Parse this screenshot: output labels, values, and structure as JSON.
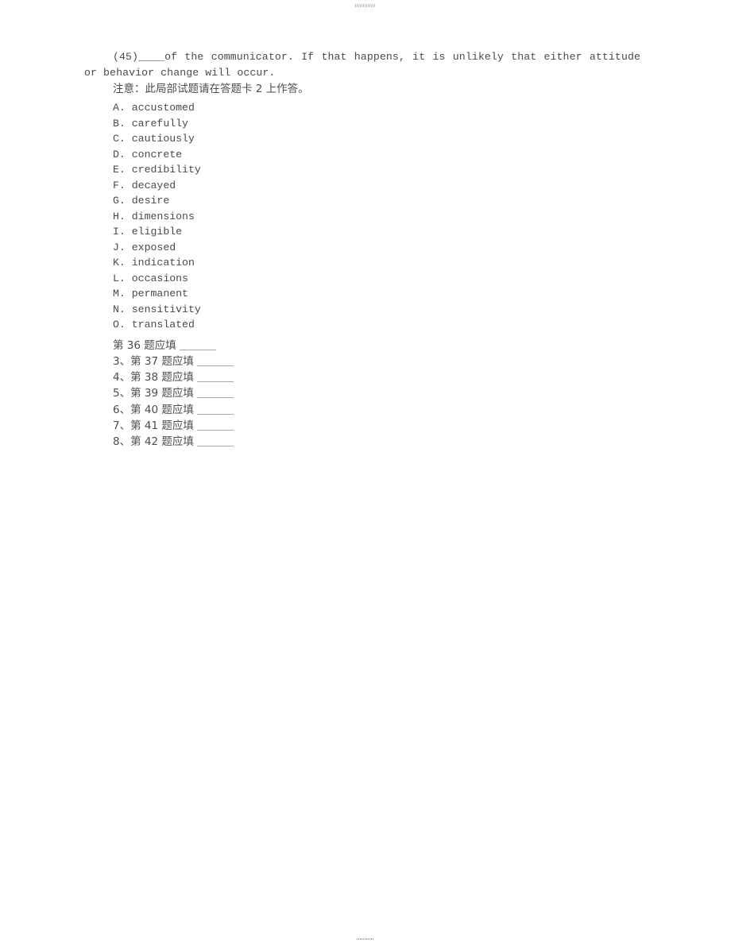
{
  "page": {
    "artifact_top": "scan-artifact-mark",
    "artifact_bottom": "scan-artifact-mark"
  },
  "passage": {
    "question_number": "(45)",
    "text_after_blank": "of the communicator. If that happens,  it is unlikely that either attitude or behavior change will occur."
  },
  "note": {
    "text": "注意：此局部试题请在答题卡 2 上作答。"
  },
  "options": [
    {
      "letter": "A.",
      "word": "accustomed"
    },
    {
      "letter": "B.",
      "word": "carefully"
    },
    {
      "letter": "C.",
      "word": "cautiously"
    },
    {
      "letter": "D.",
      "word": "concrete"
    },
    {
      "letter": "E.",
      "word": "credibility"
    },
    {
      "letter": "F.",
      "word": "decayed"
    },
    {
      "letter": "G.",
      "word": "desire"
    },
    {
      "letter": "H.",
      "word": "dimensions"
    },
    {
      "letter": "I.",
      "word": "eligible"
    },
    {
      "letter": "J.",
      "word": "exposed"
    },
    {
      "letter": "K.",
      "word": "indication"
    },
    {
      "letter": "L.",
      "word": "occasions"
    },
    {
      "letter": "M.",
      "word": "permanent"
    },
    {
      "letter": "N.",
      "word": "sensitivity"
    },
    {
      "letter": "O.",
      "word": "translated"
    }
  ],
  "answer_lines": [
    {
      "index": "",
      "label": "第 36 题应填"
    },
    {
      "index": "3、",
      "label": "第 37 题应填"
    },
    {
      "index": "4、",
      "label": "第 38 题应填"
    },
    {
      "index": "5、",
      "label": "第 39 题应填"
    },
    {
      "index": "6、",
      "label": "第 40 题应填"
    },
    {
      "index": "7、",
      "label": "第 41 题应填"
    },
    {
      "index": "8、",
      "label": "第 42 题应填"
    }
  ]
}
